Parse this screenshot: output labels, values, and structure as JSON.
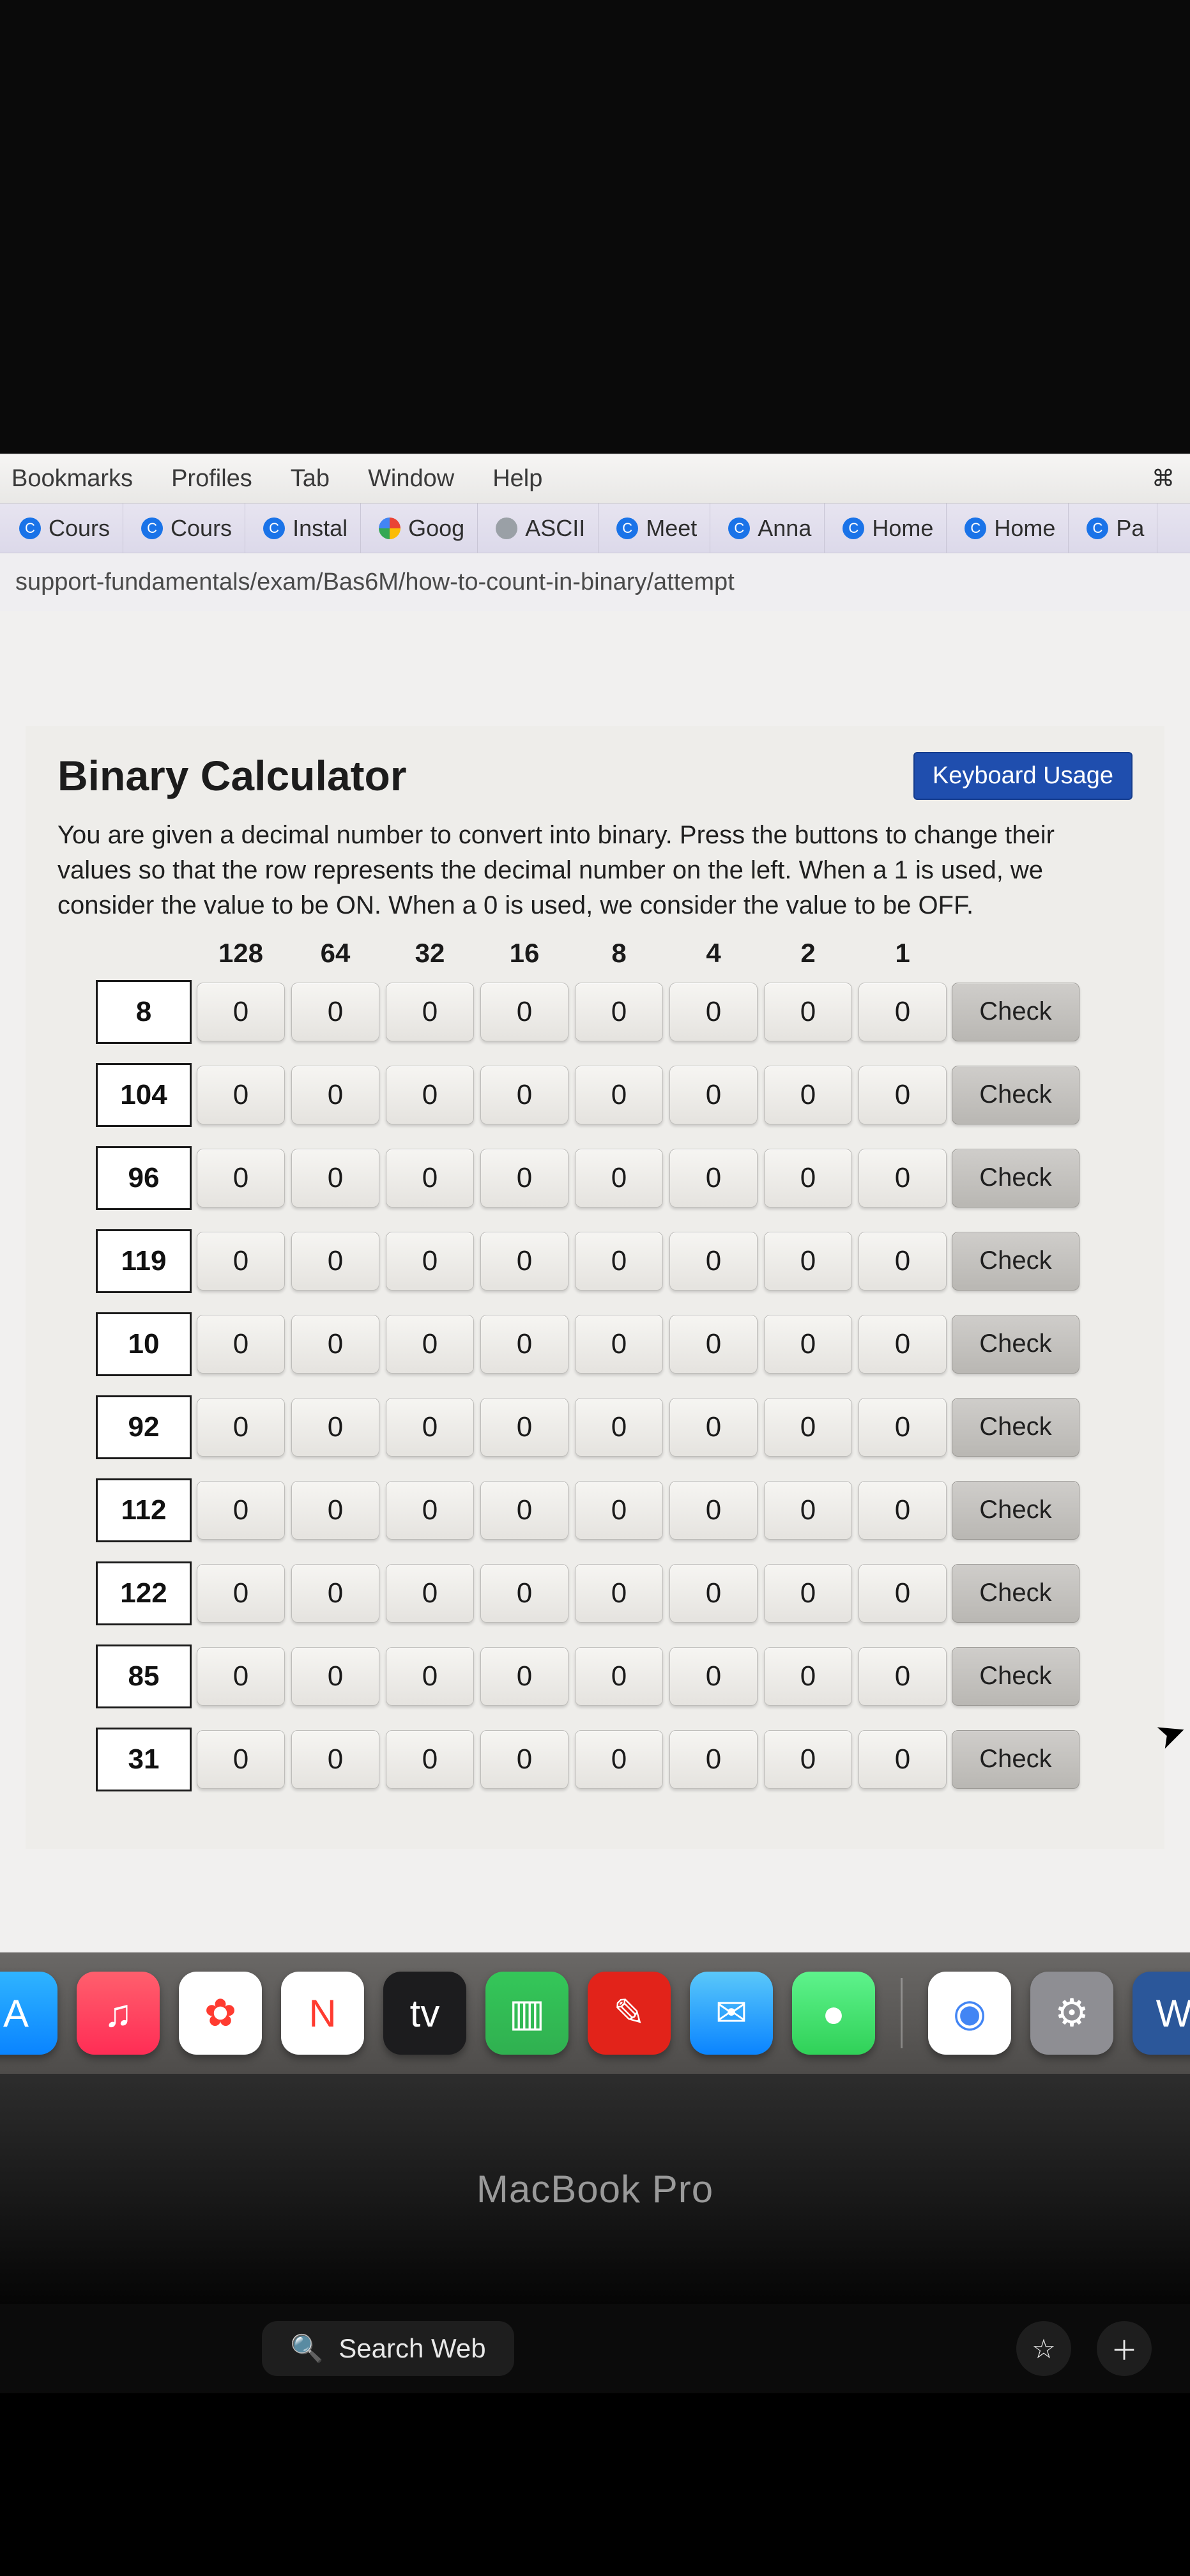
{
  "menu": {
    "items": [
      "Bookmarks",
      "Profiles",
      "Tab",
      "Window",
      "Help"
    ]
  },
  "tabs": [
    {
      "label": "Cours",
      "fav": "blue"
    },
    {
      "label": "Cours",
      "fav": "blue"
    },
    {
      "label": "Instal",
      "fav": "blue"
    },
    {
      "label": "Goog",
      "fav": "multi"
    },
    {
      "label": "ASCII",
      "fav": "gray"
    },
    {
      "label": "Meet",
      "fav": "blue"
    },
    {
      "label": "Anna",
      "fav": "blue"
    },
    {
      "label": "Home",
      "fav": "blue"
    },
    {
      "label": "Home",
      "fav": "blue"
    },
    {
      "label": "Pa",
      "fav": "blue"
    }
  ],
  "url_fragment": "support-fundamentals/exam/Bas6M/how-to-count-in-binary/attempt",
  "page": {
    "title": "Binary Calculator",
    "keyboard_button": "Keyboard Usage",
    "instructions": "You are given a decimal number to convert into binary. Press the buttons to change their values so that the row represents the decimal number on the left. When a 1 is used, we consider the value to be ON. When a 0 is used, we consider the value to be OFF.",
    "bit_headers": [
      "128",
      "64",
      "32",
      "16",
      "8",
      "4",
      "2",
      "1"
    ],
    "check_label": "Check",
    "rows": [
      {
        "decimal": "8",
        "bits": [
          "0",
          "0",
          "0",
          "0",
          "0",
          "0",
          "0",
          "0"
        ]
      },
      {
        "decimal": "104",
        "bits": [
          "0",
          "0",
          "0",
          "0",
          "0",
          "0",
          "0",
          "0"
        ]
      },
      {
        "decimal": "96",
        "bits": [
          "0",
          "0",
          "0",
          "0",
          "0",
          "0",
          "0",
          "0"
        ]
      },
      {
        "decimal": "119",
        "bits": [
          "0",
          "0",
          "0",
          "0",
          "0",
          "0",
          "0",
          "0"
        ]
      },
      {
        "decimal": "10",
        "bits": [
          "0",
          "0",
          "0",
          "0",
          "0",
          "0",
          "0",
          "0"
        ]
      },
      {
        "decimal": "92",
        "bits": [
          "0",
          "0",
          "0",
          "0",
          "0",
          "0",
          "0",
          "0"
        ]
      },
      {
        "decimal": "112",
        "bits": [
          "0",
          "0",
          "0",
          "0",
          "0",
          "0",
          "0",
          "0"
        ]
      },
      {
        "decimal": "122",
        "bits": [
          "0",
          "0",
          "0",
          "0",
          "0",
          "0",
          "0",
          "0"
        ]
      },
      {
        "decimal": "85",
        "bits": [
          "0",
          "0",
          "0",
          "0",
          "0",
          "0",
          "0",
          "0"
        ]
      },
      {
        "decimal": "31",
        "bits": [
          "0",
          "0",
          "0",
          "0",
          "0",
          "0",
          "0",
          "0"
        ]
      }
    ]
  },
  "dock": [
    {
      "name": "app-store",
      "glyph": "A",
      "bg": "linear-gradient(#2fb4ff,#0a84ff)"
    },
    {
      "name": "music",
      "glyph": "♫",
      "bg": "linear-gradient(#ff5f6d,#ff2d55)"
    },
    {
      "name": "photos",
      "glyph": "✿",
      "bg": "#fff",
      "fg": "#ff3b30"
    },
    {
      "name": "news",
      "glyph": "N",
      "bg": "#fff",
      "fg": "#ff3b30"
    },
    {
      "name": "apple-tv",
      "glyph": "tv",
      "bg": "#1c1c1e"
    },
    {
      "name": "numbers",
      "glyph": "▥",
      "bg": "linear-gradient(#34c759,#30b050)"
    },
    {
      "name": "acrobat",
      "glyph": "✎",
      "bg": "#e2231a"
    },
    {
      "name": "mail",
      "glyph": "✉",
      "bg": "linear-gradient(#5ac8fa,#0a84ff)"
    },
    {
      "name": "messages",
      "glyph": "●",
      "bg": "linear-gradient(#5ef38c,#30d158)"
    },
    {
      "name": "separator"
    },
    {
      "name": "chrome",
      "glyph": "◉",
      "bg": "#fff",
      "fg": "#4285f4"
    },
    {
      "name": "settings",
      "glyph": "⚙",
      "bg": "#8e8e93"
    },
    {
      "name": "word",
      "glyph": "W",
      "bg": "#2b579a"
    }
  ],
  "laptop_label": "MacBook Pro",
  "touchbar": {
    "search": "Search Web"
  }
}
